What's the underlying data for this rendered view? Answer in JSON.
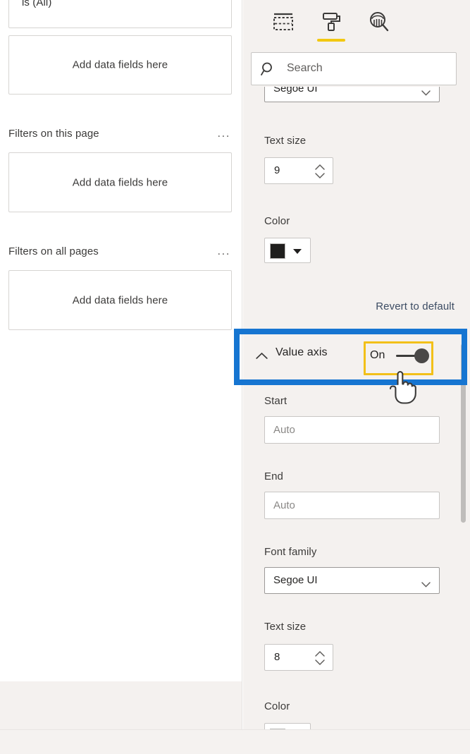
{
  "filters_pane": {
    "top_filter_card": {
      "value_text": "is (All)"
    },
    "groups": [
      {
        "name": "filters-on-visual-dropzone",
        "title": null,
        "dropzone_text": "Add data fields here"
      },
      {
        "name": "filters-on-this-page",
        "title": "Filters on this page",
        "more_options": "...",
        "dropzone_text": "Add data fields here"
      },
      {
        "name": "filters-on-all-pages",
        "title": "Filters on all pages",
        "more_options": "...",
        "dropzone_text": "Add data fields here"
      }
    ]
  },
  "format_pane": {
    "tabs": [
      {
        "name": "build-visual-tab",
        "icon": "table-fields-icon",
        "active": false
      },
      {
        "name": "format-visual-tab",
        "icon": "paint-roller-icon",
        "active": true
      },
      {
        "name": "analytics-tab",
        "icon": "chart-magnifier-icon",
        "active": false
      }
    ],
    "search": {
      "placeholder": "Search",
      "icon": "search-icon"
    },
    "upper_section": {
      "font_family_value": "Segoe UI",
      "text_size_label": "Text size",
      "text_size_value": "9",
      "color_label": "Color",
      "color_value": "#201f1e",
      "revert_label": "Revert to default"
    },
    "value_axis": {
      "section_title": "Value axis",
      "collapse_icon": "chevron-up-icon",
      "toggle_label": "On",
      "toggle_state": "on",
      "start_label": "Start",
      "start_placeholder": "Auto",
      "end_label": "End",
      "end_placeholder": "Auto",
      "font_family_label": "Font family",
      "font_family_value": "Segoe UI",
      "text_size_label": "Text size",
      "text_size_value": "8",
      "color_label": "Color"
    }
  },
  "annotations": {
    "highlight_rect_color": "#1675d1",
    "focus_box_color": "#f2c019",
    "cursor": "hand-pointer-cursor"
  }
}
